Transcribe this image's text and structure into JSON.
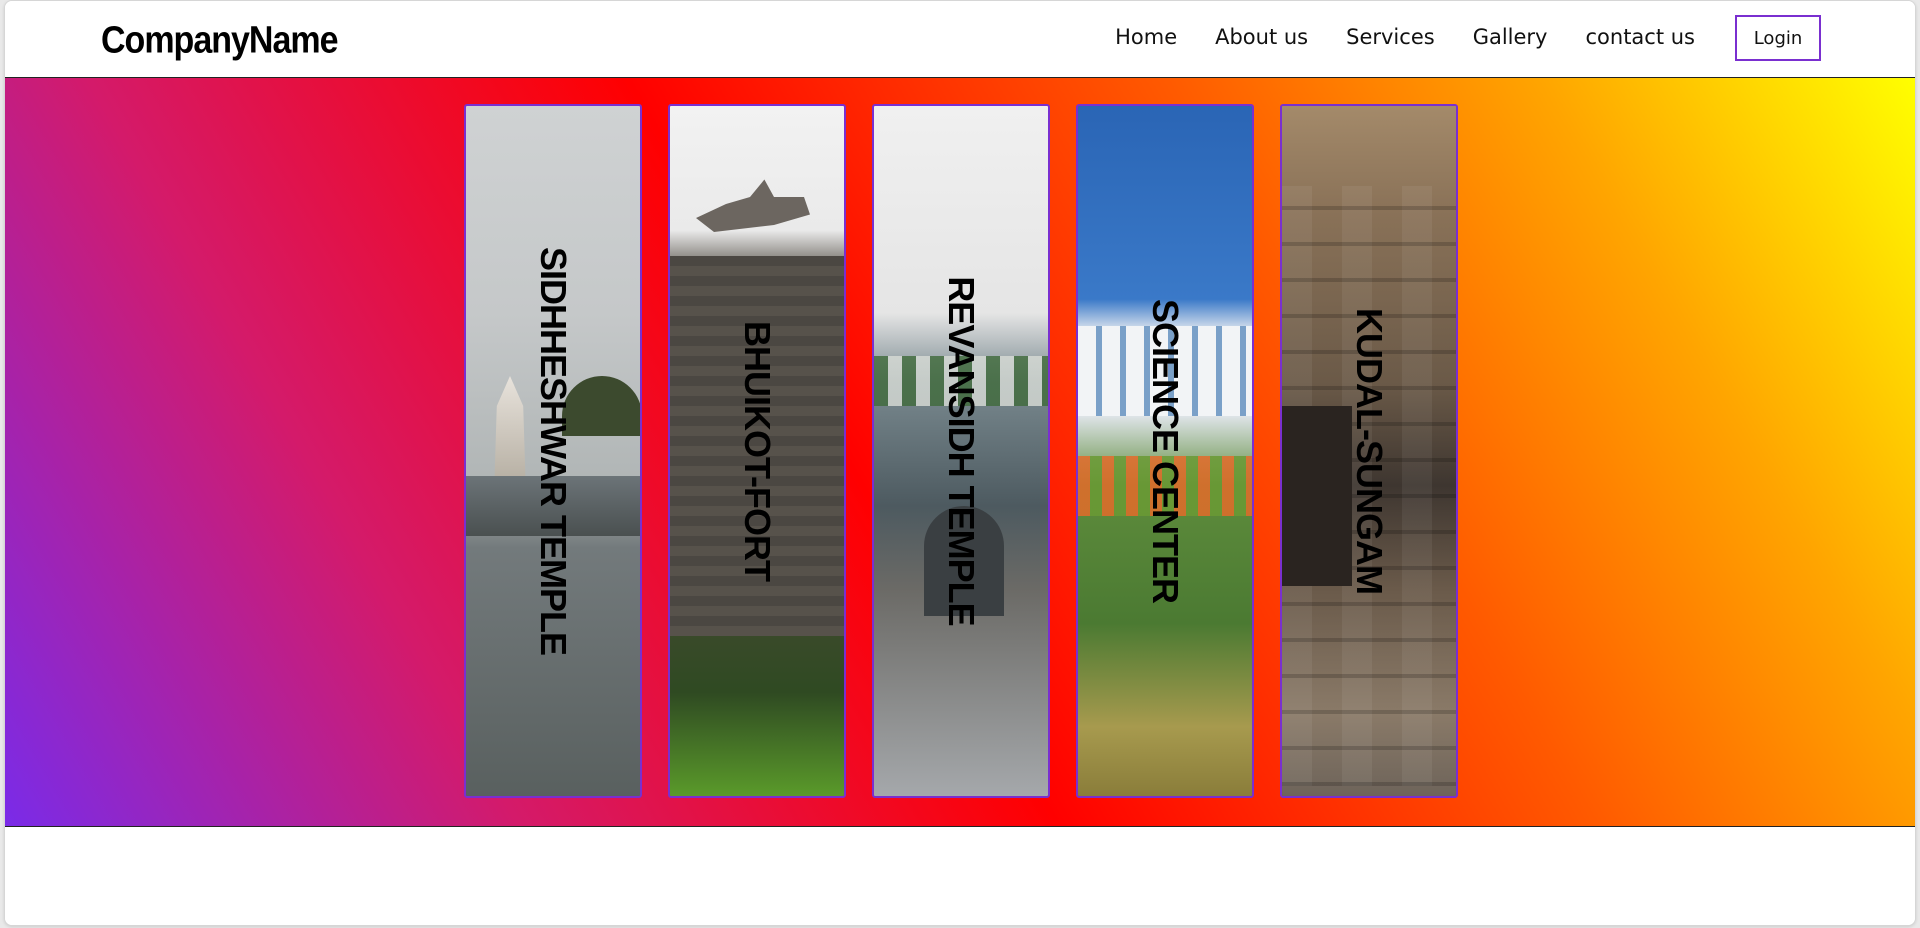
{
  "brand": {
    "name": "CompanyName"
  },
  "nav": {
    "links": [
      "Home",
      "About us",
      "Services",
      "Gallery",
      "contact us"
    ],
    "login_label": "Login"
  },
  "hero": {
    "gradient_colors": [
      "#7a2be8",
      "#d41a6a",
      "#ff0000",
      "#ff5a00",
      "#ffa500",
      "#ffff00"
    ],
    "panel_border_color": "#7a2fd0",
    "panels": [
      {
        "label": "SIDHHESHWAR TEMPLE"
      },
      {
        "label": "BHUIKOT-FORT"
      },
      {
        "label": "REVANSIDH TEMPLE"
      },
      {
        "label": "SCIENCE CENTER"
      },
      {
        "label": "KUDAL-SUNGAM"
      }
    ]
  }
}
